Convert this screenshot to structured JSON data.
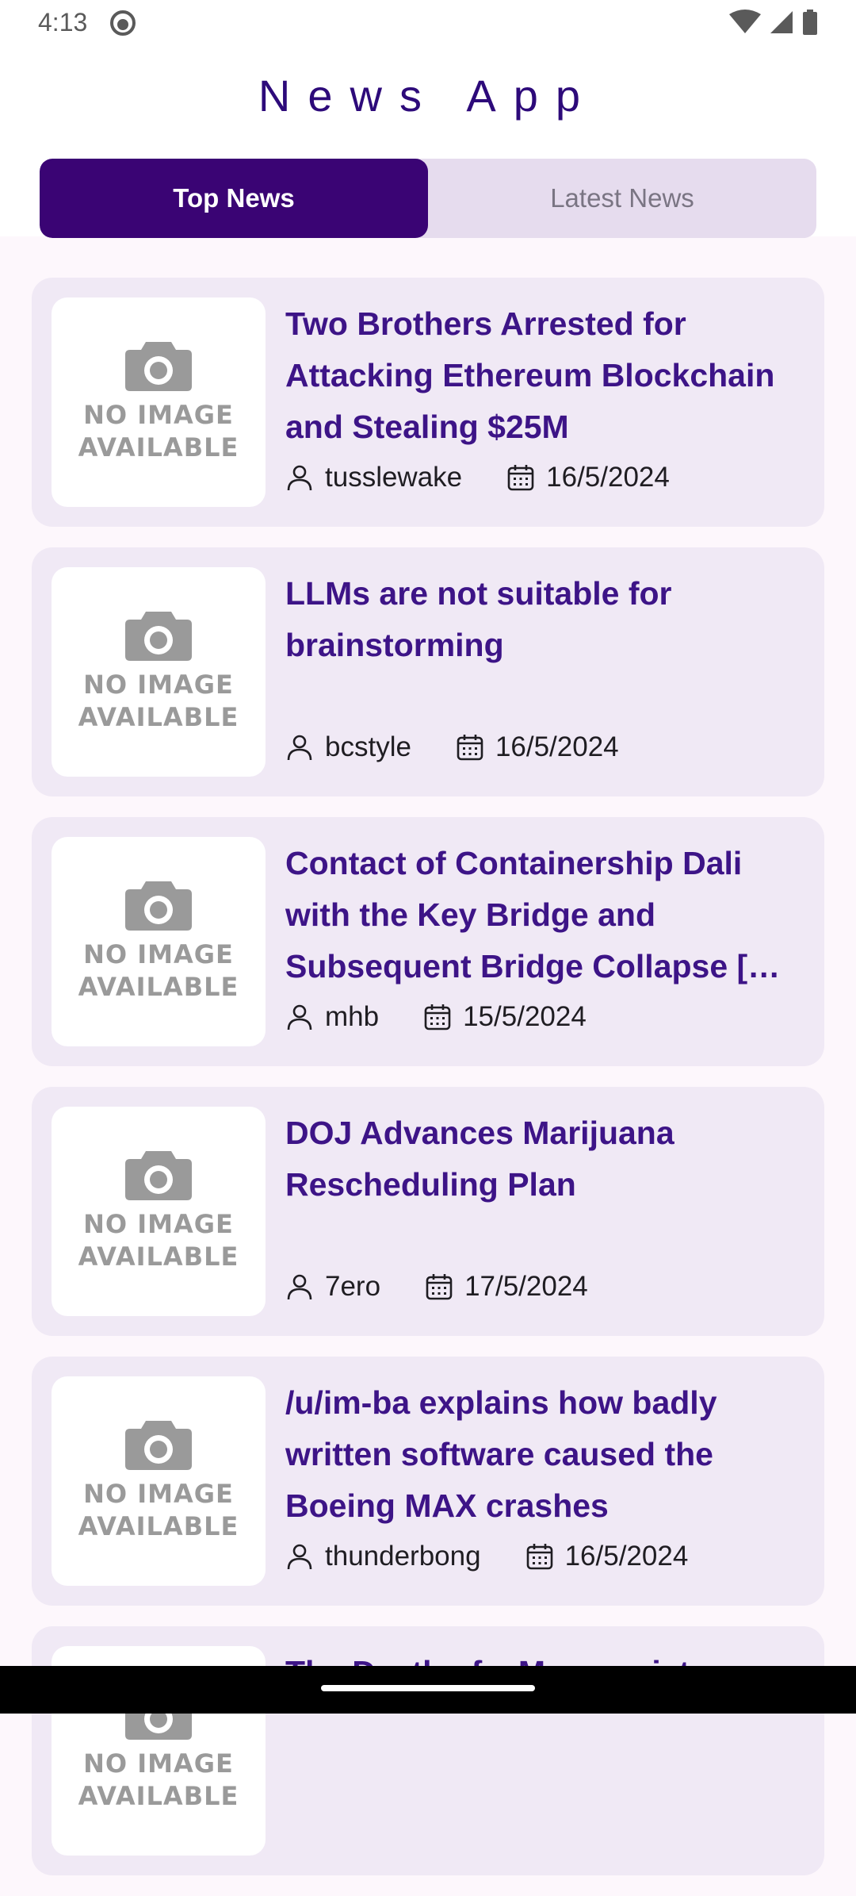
{
  "status": {
    "time": "4:13"
  },
  "app": {
    "title": "News App"
  },
  "tabs": [
    {
      "label": "Top News",
      "active": true
    },
    {
      "label": "Latest News",
      "active": false
    }
  ],
  "placeholder": {
    "line1": "NO IMAGE",
    "line2": "AVAILABLE"
  },
  "articles": [
    {
      "title": "Two Brothers Arrested for Attacking Ethereum Blockchain and Stealing $25M",
      "author": "tusslewake",
      "date": "16/5/2024"
    },
    {
      "title": "LLMs are not suitable for brainstorming",
      "author": "bcstyle",
      "date": "16/5/2024"
    },
    {
      "title": "Contact of Containership Dali with the Key Bridge and Subsequent Bridge Collapse […",
      "author": "mhb",
      "date": "15/5/2024"
    },
    {
      "title": "DOJ Advances Marijuana Rescheduling Plan",
      "author": "7ero",
      "date": "17/5/2024"
    },
    {
      "title": "/u/im-ba explains how badly written software caused the Boeing MAX crashes",
      "author": "thunderbong",
      "date": "16/5/2024"
    },
    {
      "title": "The Death of a Mnemonist",
      "author": "",
      "date": ""
    }
  ],
  "colors": {
    "accent": "#3a0474",
    "title": "#3d1487",
    "card": "#f0e9f5",
    "tabs_bg": "#e6dcee"
  }
}
